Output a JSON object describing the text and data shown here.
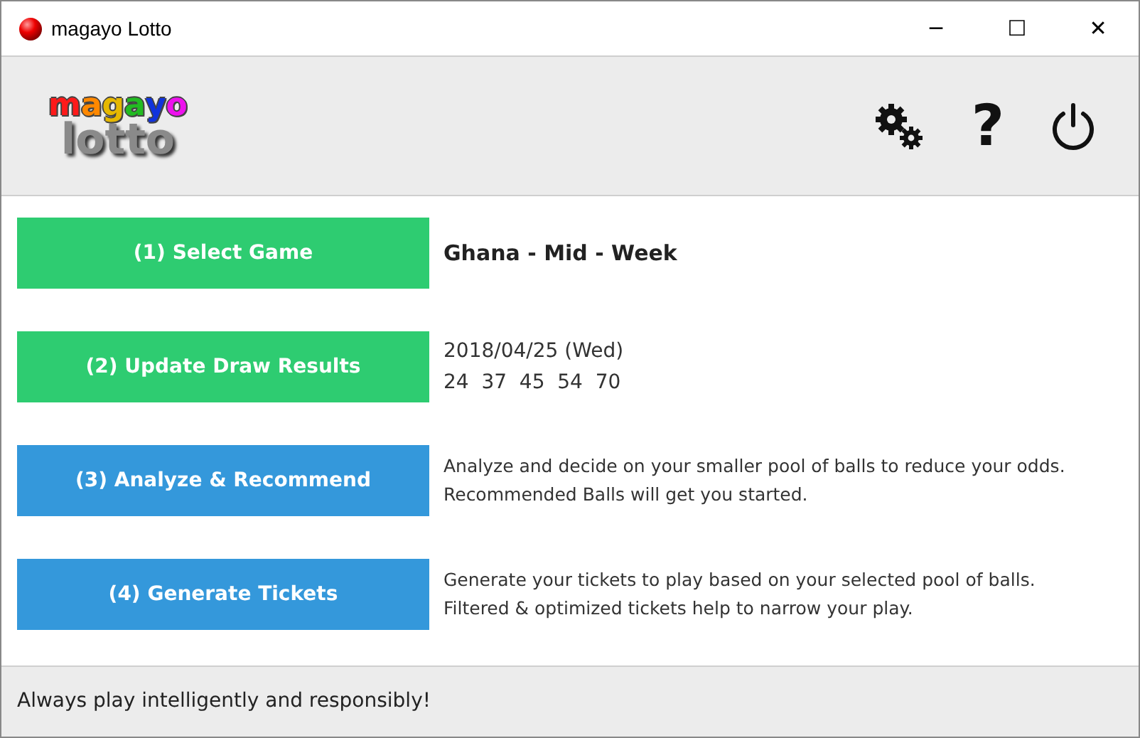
{
  "window": {
    "title": "magayo Lotto",
    "controls": [
      "─",
      "☐",
      "✕"
    ]
  },
  "logo": {
    "top": [
      {
        "letter": "m",
        "color": "#ff1a1a"
      },
      {
        "letter": "a",
        "color": "#ff8800"
      },
      {
        "letter": "g",
        "color": "#e6b800"
      },
      {
        "letter": "a",
        "color": "#22bb22"
      },
      {
        "letter": "y",
        "color": "#1133dd"
      },
      {
        "letter": "o",
        "color": "#ee11ee"
      }
    ],
    "bottom": "lotto"
  },
  "toolbar": [
    "?"
  ],
  "steps": [
    {
      "label": "(1) Select Game",
      "color": "#2ecc71",
      "kind": "title",
      "lines": [
        "Ghana - Mid - Week"
      ]
    },
    {
      "label": "(2) Update Draw Results",
      "color": "#2ecc71",
      "kind": "draw",
      "lines": [
        "2018/04/25 (Wed)",
        "24  37  45  54  70"
      ]
    },
    {
      "label": "(3) Analyze & Recommend",
      "color": "#3498db",
      "kind": "note",
      "lines": [
        "Analyze and decide on your smaller pool of balls to reduce your odds.",
        "Recommended Balls will get you started."
      ]
    },
    {
      "label": "(4) Generate Tickets",
      "color": "#3498db",
      "kind": "note",
      "lines": [
        "Generate your tickets to play based on your selected pool of balls.",
        "Filtered & optimized tickets help to narrow your play."
      ]
    }
  ],
  "status_bar": "Always play intelligently and responsibly!"
}
